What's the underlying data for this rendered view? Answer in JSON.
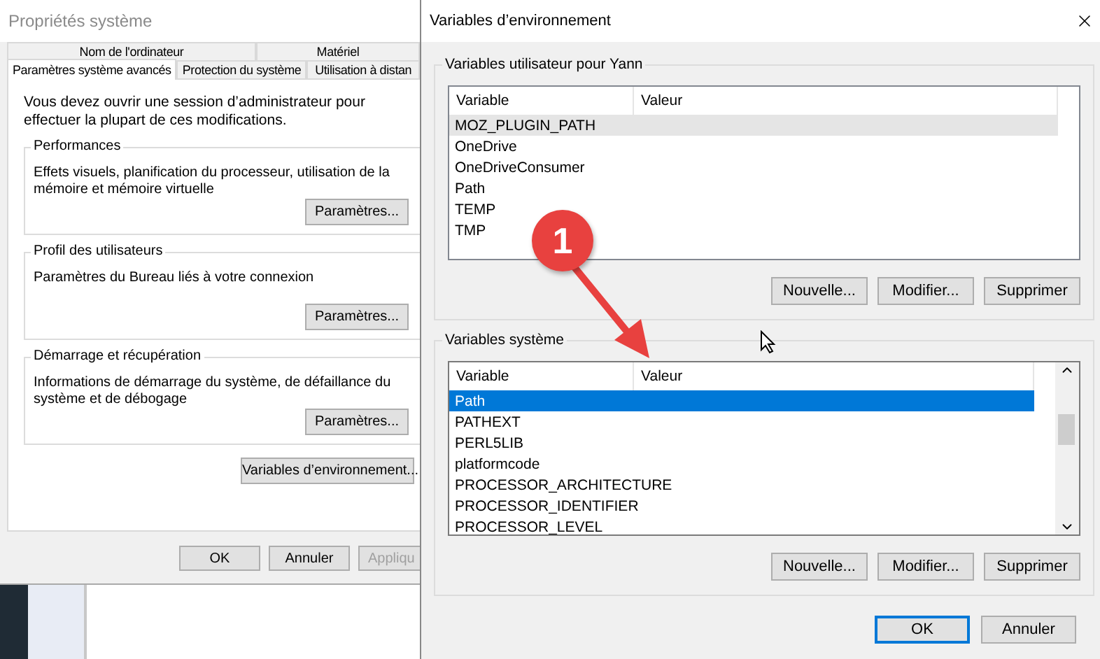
{
  "system_properties": {
    "title": "Propriétés système",
    "tab_rows": [
      {
        "tabs": [
          {
            "label": "Nom de l'ordinateur",
            "selected": false
          },
          {
            "label": "Matériel",
            "selected": false
          }
        ]
      },
      {
        "tabs": [
          {
            "label": "Paramètres système avancés",
            "selected": true
          },
          {
            "label": "Protection du système",
            "selected": false
          },
          {
            "label": "Utilisation à distan",
            "selected": false
          }
        ]
      }
    ],
    "notice": "Vous devez ouvrir une session d’administrateur pour effectuer la plupart de ces modifications.",
    "groups": [
      {
        "title": "Performances",
        "description": "Effets visuels, planification du processeur, utilisation de la mémoire et mémoire virtuelle",
        "button": "Paramètres..."
      },
      {
        "title": "Profil des utilisateurs",
        "description": "Paramètres du Bureau liés à votre connexion",
        "button": "Paramètres..."
      },
      {
        "title": "Démarrage et récupération",
        "description": "Informations de démarrage du système, de défaillance du système et de débogage",
        "button": "Paramètres..."
      }
    ],
    "env_button": "Variables d’environnement...",
    "buttons": [
      {
        "label": "OK",
        "disabled": false
      },
      {
        "label": "Annuler",
        "disabled": false
      },
      {
        "label": "Appliqu",
        "disabled": true
      }
    ]
  },
  "environment_variables": {
    "title": "Variables d’environnement",
    "sections": [
      {
        "title": "Variables utilisateur pour Yann",
        "focused": false,
        "columns": [
          "Variable",
          "Valeur"
        ],
        "rows": [
          {
            "variable": "MOZ_PLUGIN_PATH",
            "selected": true
          },
          {
            "variable": "OneDrive",
            "selected": false
          },
          {
            "variable": "OneDriveConsumer",
            "selected": false
          },
          {
            "variable": "Path",
            "selected": false
          },
          {
            "variable": "TEMP",
            "selected": false
          },
          {
            "variable": "TMP",
            "selected": false
          }
        ],
        "buttons": [
          "Nouvelle...",
          "Modifier...",
          "Supprimer"
        ]
      },
      {
        "title": "Variables système",
        "focused": true,
        "scrollable": true,
        "columns": [
          "Variable",
          "Valeur"
        ],
        "rows": [
          {
            "variable": "Path",
            "selected": true
          },
          {
            "variable": "PATHEXT",
            "selected": false
          },
          {
            "variable": "PERL5LIB",
            "selected": false
          },
          {
            "variable": "platformcode",
            "selected": false
          },
          {
            "variable": "PROCESSOR_ARCHITECTURE",
            "selected": false
          },
          {
            "variable": "PROCESSOR_IDENTIFIER",
            "selected": false
          },
          {
            "variable": "PROCESSOR_LEVEL",
            "selected": false
          }
        ],
        "buttons": [
          "Nouvelle...",
          "Modifier...",
          "Supprimer"
        ]
      }
    ],
    "buttons": [
      {
        "label": "OK",
        "default": true
      },
      {
        "label": "Annuler",
        "default": false
      }
    ]
  },
  "annotation": {
    "number": "1"
  }
}
